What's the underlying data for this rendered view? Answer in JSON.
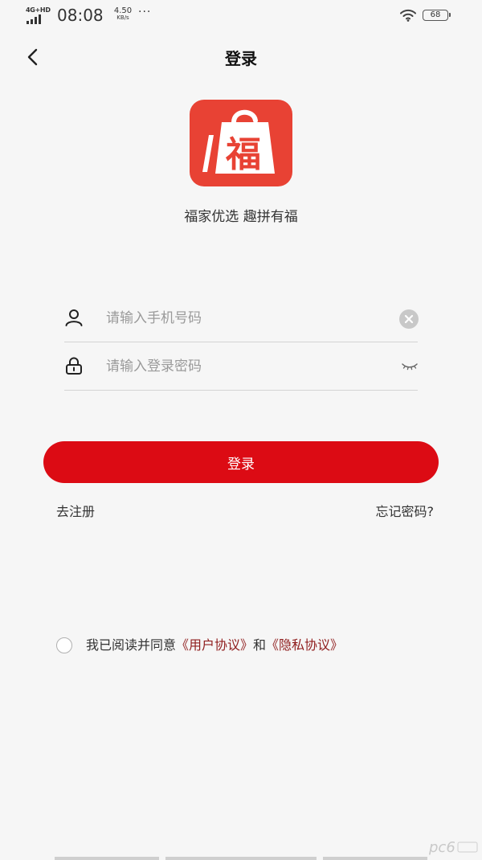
{
  "status_bar": {
    "network": "4G+HD",
    "time": "08:08",
    "speed_value": "4.50",
    "speed_unit": "KB/s",
    "more": "···",
    "battery": "68"
  },
  "nav": {
    "title": "登录"
  },
  "logo": {
    "char": "福",
    "brand_color": "#e84234"
  },
  "slogan": "福家优选 趣拼有福",
  "form": {
    "phone": {
      "value": "",
      "placeholder": "请输入手机号码"
    },
    "password": {
      "value": "",
      "placeholder": "请输入登录密码"
    }
  },
  "login_button": {
    "label": "登录",
    "color": "#dc0b14"
  },
  "links": {
    "register": "去注册",
    "forgot": "忘记密码?"
  },
  "agreement": {
    "checked": false,
    "prefix": "我已阅读并同意",
    "user_agreement": "《用户协议》",
    "conjunction": "和",
    "privacy_agreement": "《隐私协议》",
    "link_color": "#8f1d1d"
  },
  "icons": {
    "back": "chevron-left-icon",
    "user": "user-icon",
    "lock": "lock-icon",
    "clear": "clear-icon",
    "eye": "eye-closed-icon",
    "wifi": "wifi-icon",
    "signal": "signal-icon",
    "battery": "battery-icon"
  }
}
